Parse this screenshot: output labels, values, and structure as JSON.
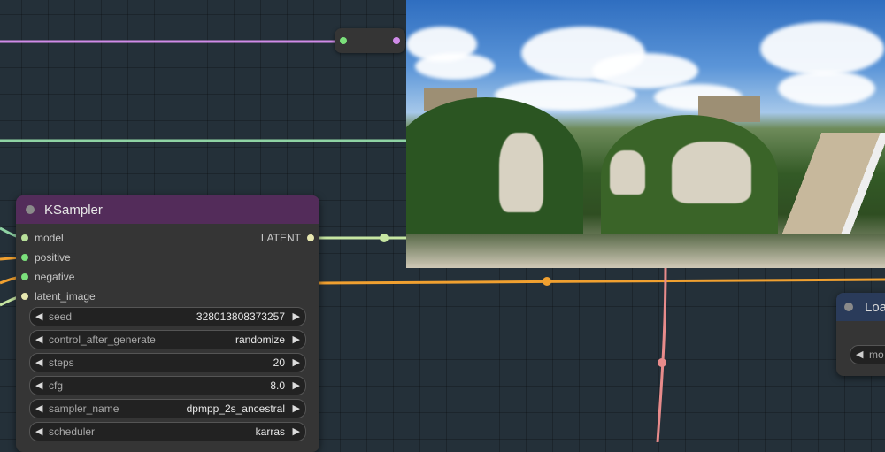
{
  "colors": {
    "canvas_bg": "#243039",
    "node_bg": "#353535",
    "ksampler_header": "#532c5a",
    "loader_header": "#2a3b5a",
    "wire_clip": "#d08be8",
    "wire_conditioning": "#8fd3a4",
    "wire_latent": "#c6e6a2",
    "wire_vae": "#f0a030",
    "wire_image": "#e88b8b",
    "slot_model": "#b8e09a",
    "slot_conditioning": "#7be07b"
  },
  "ksampler": {
    "title": "KSampler",
    "inputs": [
      "model",
      "positive",
      "negative",
      "latent_image"
    ],
    "output": "LATENT",
    "widgets": [
      {
        "label": "seed",
        "value": "328013808373257"
      },
      {
        "label": "control_after_generate",
        "value": "randomize"
      },
      {
        "label": "steps",
        "value": "20"
      },
      {
        "label": "cfg",
        "value": "8.0"
      },
      {
        "label": "sampler_name",
        "value": "dpmpp_2s_ancestral"
      },
      {
        "label": "scheduler",
        "value": "karras"
      }
    ]
  },
  "loader": {
    "title": "Loa",
    "widget_label": "mo"
  },
  "preview": {
    "icon": "generated-image"
  }
}
